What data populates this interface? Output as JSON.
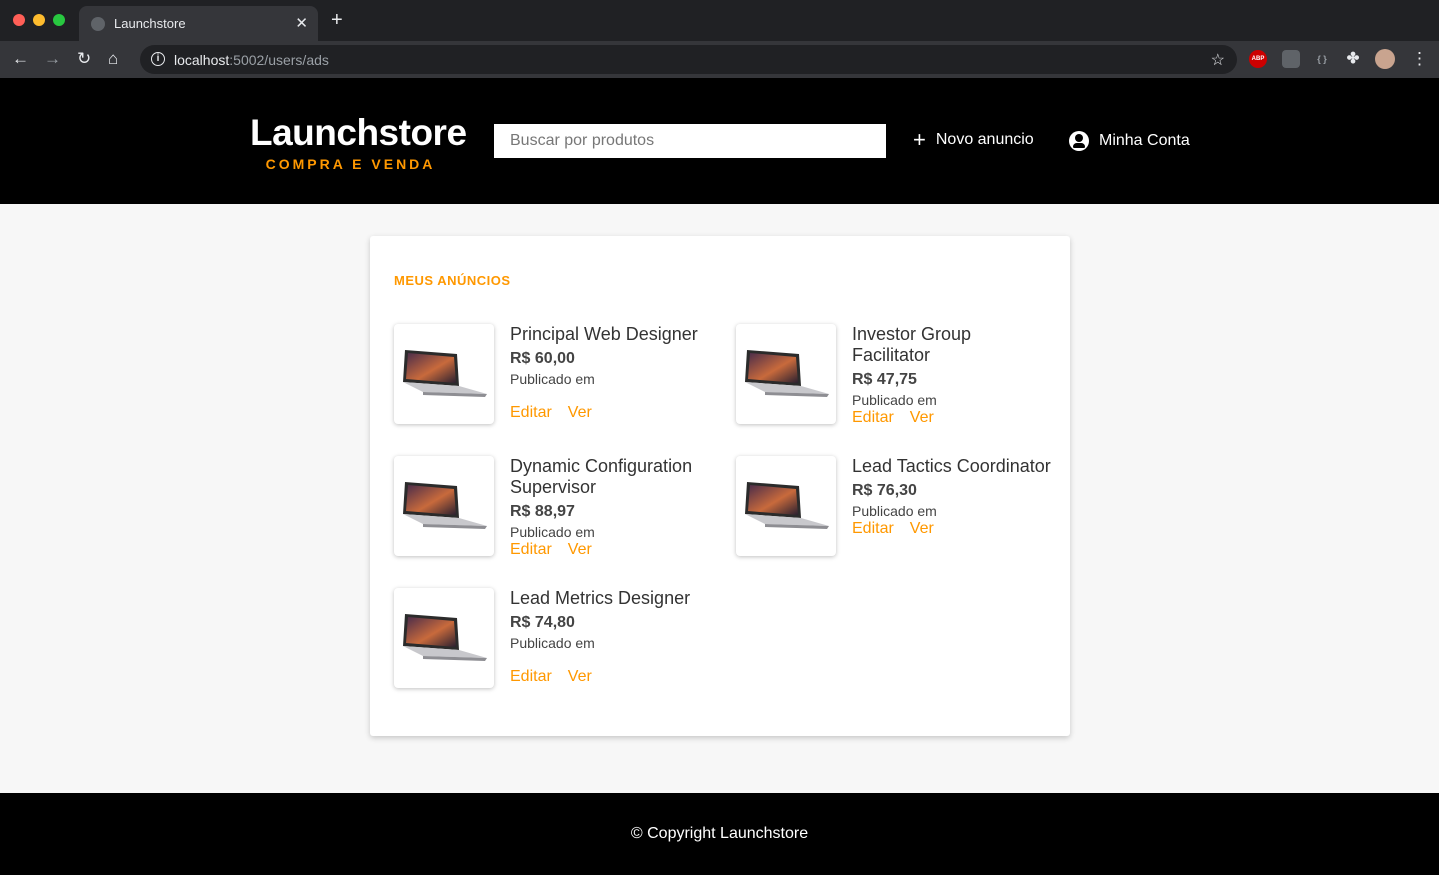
{
  "browser": {
    "tab_title": "Launchstore",
    "url_host": "localhost",
    "url_path": ":5002/users/ads",
    "extensions": {
      "abp": "ABP",
      "braces": "{ }"
    }
  },
  "header": {
    "logo_title": "Launchstore",
    "logo_subtitle": "COMPRA E VENDA",
    "search_placeholder": "Buscar por produtos",
    "new_ad_label": "Novo anuncio",
    "account_label": "Minha Conta"
  },
  "main": {
    "section_title": "MEUS ANÚNCIOS",
    "ads": [
      {
        "name": "Principal Web Designer",
        "price": "R$ 60,00",
        "published": "Publicado em",
        "edit_label": "Editar",
        "view_label": "Ver"
      },
      {
        "name": "Investor Group Facilitator",
        "price": "R$ 47,75",
        "published": "Publicado em",
        "edit_label": "Editar",
        "view_label": "Ver"
      },
      {
        "name": "Dynamic Configuration Supervisor",
        "price": "R$ 88,97",
        "published": "Publicado em",
        "edit_label": "Editar",
        "view_label": "Ver"
      },
      {
        "name": "Lead Tactics Coordinator",
        "price": "R$ 76,30",
        "published": "Publicado em",
        "edit_label": "Editar",
        "view_label": "Ver"
      },
      {
        "name": "Lead Metrics Designer",
        "price": "R$ 74,80",
        "published": "Publicado em",
        "edit_label": "Editar",
        "view_label": "Ver"
      }
    ]
  },
  "footer": {
    "copyright": "© Copyright Launchstore"
  },
  "colors": {
    "accent": "#ff9800",
    "header_bg": "#000000",
    "page_bg": "#f7f7f7"
  }
}
